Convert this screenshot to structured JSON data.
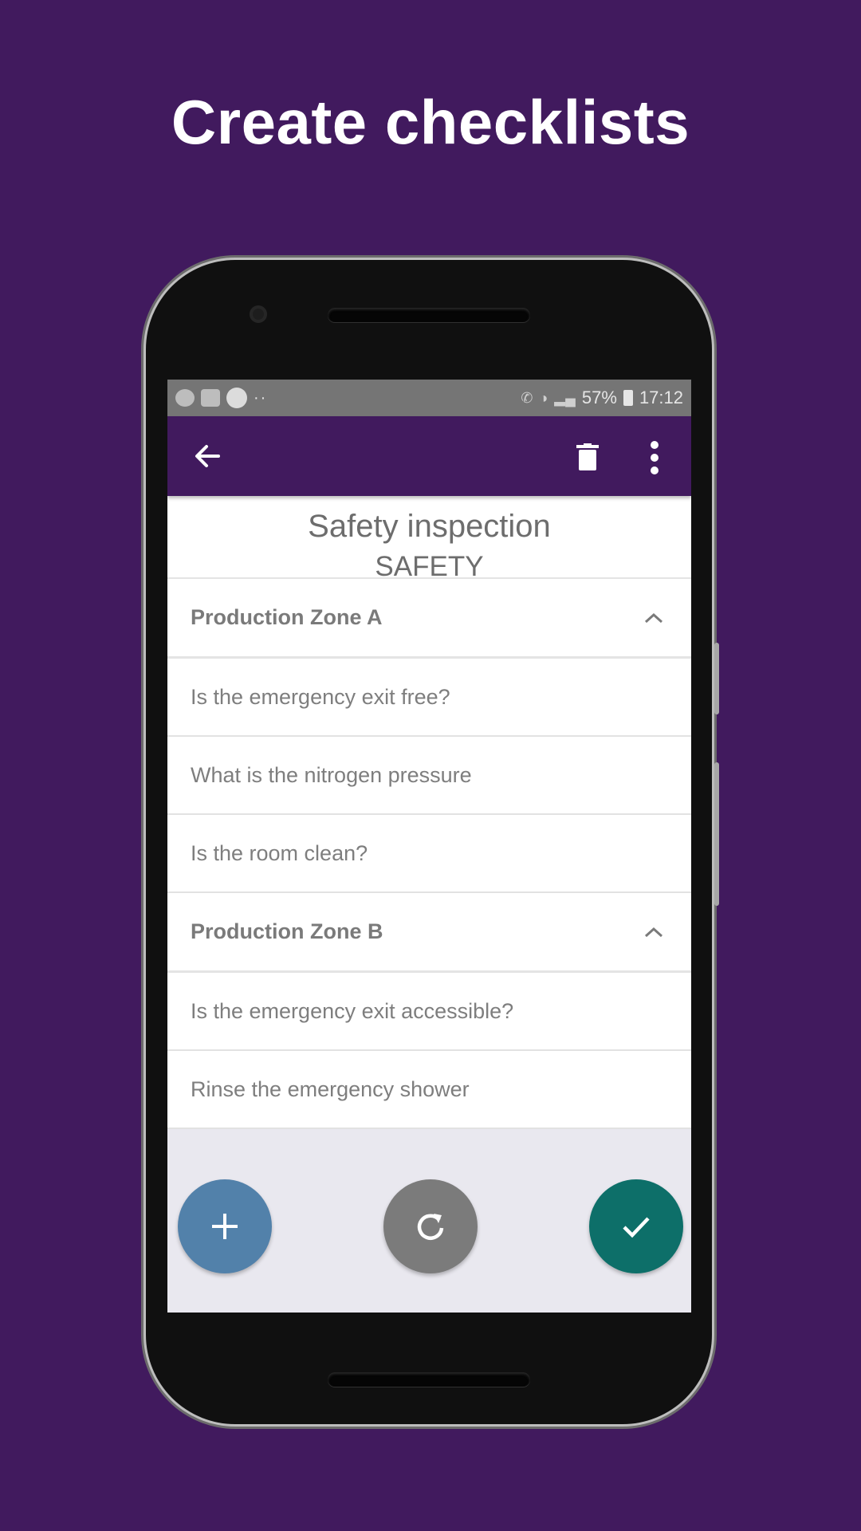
{
  "headline": "Create checklists",
  "colors": {
    "background": "#411a5e",
    "app_bar": "#411a5e",
    "status_bar": "#757575",
    "fab_add": "#5281aa",
    "fab_refresh": "#7b7b7b",
    "fab_confirm": "#0d6f69"
  },
  "status_bar": {
    "left_icons": [
      "whatsapp-icon",
      "gallery-icon",
      "app-notification-icon"
    ],
    "more_notifications": "··",
    "right_icons": [
      "wifi-call-icon",
      "wifi-icon",
      "signal-icon",
      "battery-icon"
    ],
    "battery": "57%",
    "time": "17:12"
  },
  "app_bar": {
    "back_icon": "arrow-back-icon",
    "delete_icon": "trash-icon",
    "menu_icon": "more-vert-icon"
  },
  "checklist": {
    "title": "Safety inspection",
    "category": "SAFETY",
    "sections": [
      {
        "label": "Production Zone A",
        "expanded": true,
        "items": [
          "Is the emergency exit free?",
          "What is the nitrogen pressure",
          "Is the room clean?"
        ]
      },
      {
        "label": "Production Zone B",
        "expanded": true,
        "items": [
          "Is the emergency exit accessible?",
          "Rinse the emergency shower"
        ]
      }
    ]
  },
  "fabs": {
    "add_icon": "plus-icon",
    "refresh_icon": "refresh-icon",
    "confirm_icon": "check-icon"
  }
}
